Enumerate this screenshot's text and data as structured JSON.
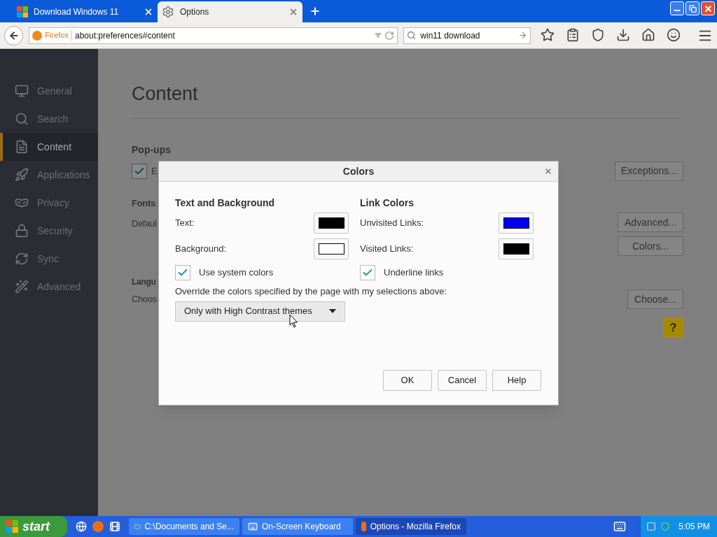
{
  "browser": {
    "tabs": [
      {
        "title": "Download Windows 11",
        "selected": false
      },
      {
        "title": "Options",
        "selected": true
      }
    ],
    "identity": "Firefox",
    "url": "about:preferences#content",
    "search": "win11 download"
  },
  "sidebar": {
    "items": [
      {
        "label": "General",
        "selected": false
      },
      {
        "label": "Search",
        "selected": false
      },
      {
        "label": "Content",
        "selected": true
      },
      {
        "label": "Applications",
        "selected": false
      },
      {
        "label": "Privacy",
        "selected": false
      },
      {
        "label": "Security",
        "selected": false
      },
      {
        "label": "Sync",
        "selected": false
      },
      {
        "label": "Advanced",
        "selected": false
      }
    ]
  },
  "page": {
    "heading": "Content",
    "popups": {
      "heading": "Pop-ups",
      "checkbox_label": "E",
      "checked": true,
      "button": "Exceptions..."
    },
    "fonts": {
      "heading": "Fonts",
      "text": "Defaul",
      "buttons": [
        "Advanced...",
        "Colors..."
      ]
    },
    "languages": {
      "heading": "Langu",
      "text": "Choos",
      "button": "Choose..."
    },
    "help": "?"
  },
  "dialog": {
    "title": "Colors",
    "groups": [
      {
        "heading": "Text and Background",
        "rows": [
          {
            "label": "Text:",
            "color": "#000000"
          },
          {
            "label": "Background:",
            "color": "#ffffff"
          }
        ],
        "checkbox": {
          "label": "Use system colors",
          "checked": true
        }
      },
      {
        "heading": "Link Colors",
        "rows": [
          {
            "label": "Unvisited Links:",
            "color": "#0000ee"
          },
          {
            "label": "Visited Links:",
            "color": "#000000"
          }
        ],
        "checkbox": {
          "label": "Underline links",
          "checked": true
        }
      }
    ],
    "override_label": "Override the colors specified by the page with my selections above:",
    "override_value": "Only with High Contrast themes",
    "buttons": [
      "OK",
      "Cancel",
      "Help"
    ]
  },
  "taskbar": {
    "start": "start",
    "tasks": [
      {
        "label": "C:\\Documents and Se...",
        "selected": false
      },
      {
        "label": "On-Screen Keyboard",
        "selected": false
      },
      {
        "label": "Options - Mozilla Firefox",
        "selected": true
      }
    ],
    "clock": "5:05 PM"
  }
}
